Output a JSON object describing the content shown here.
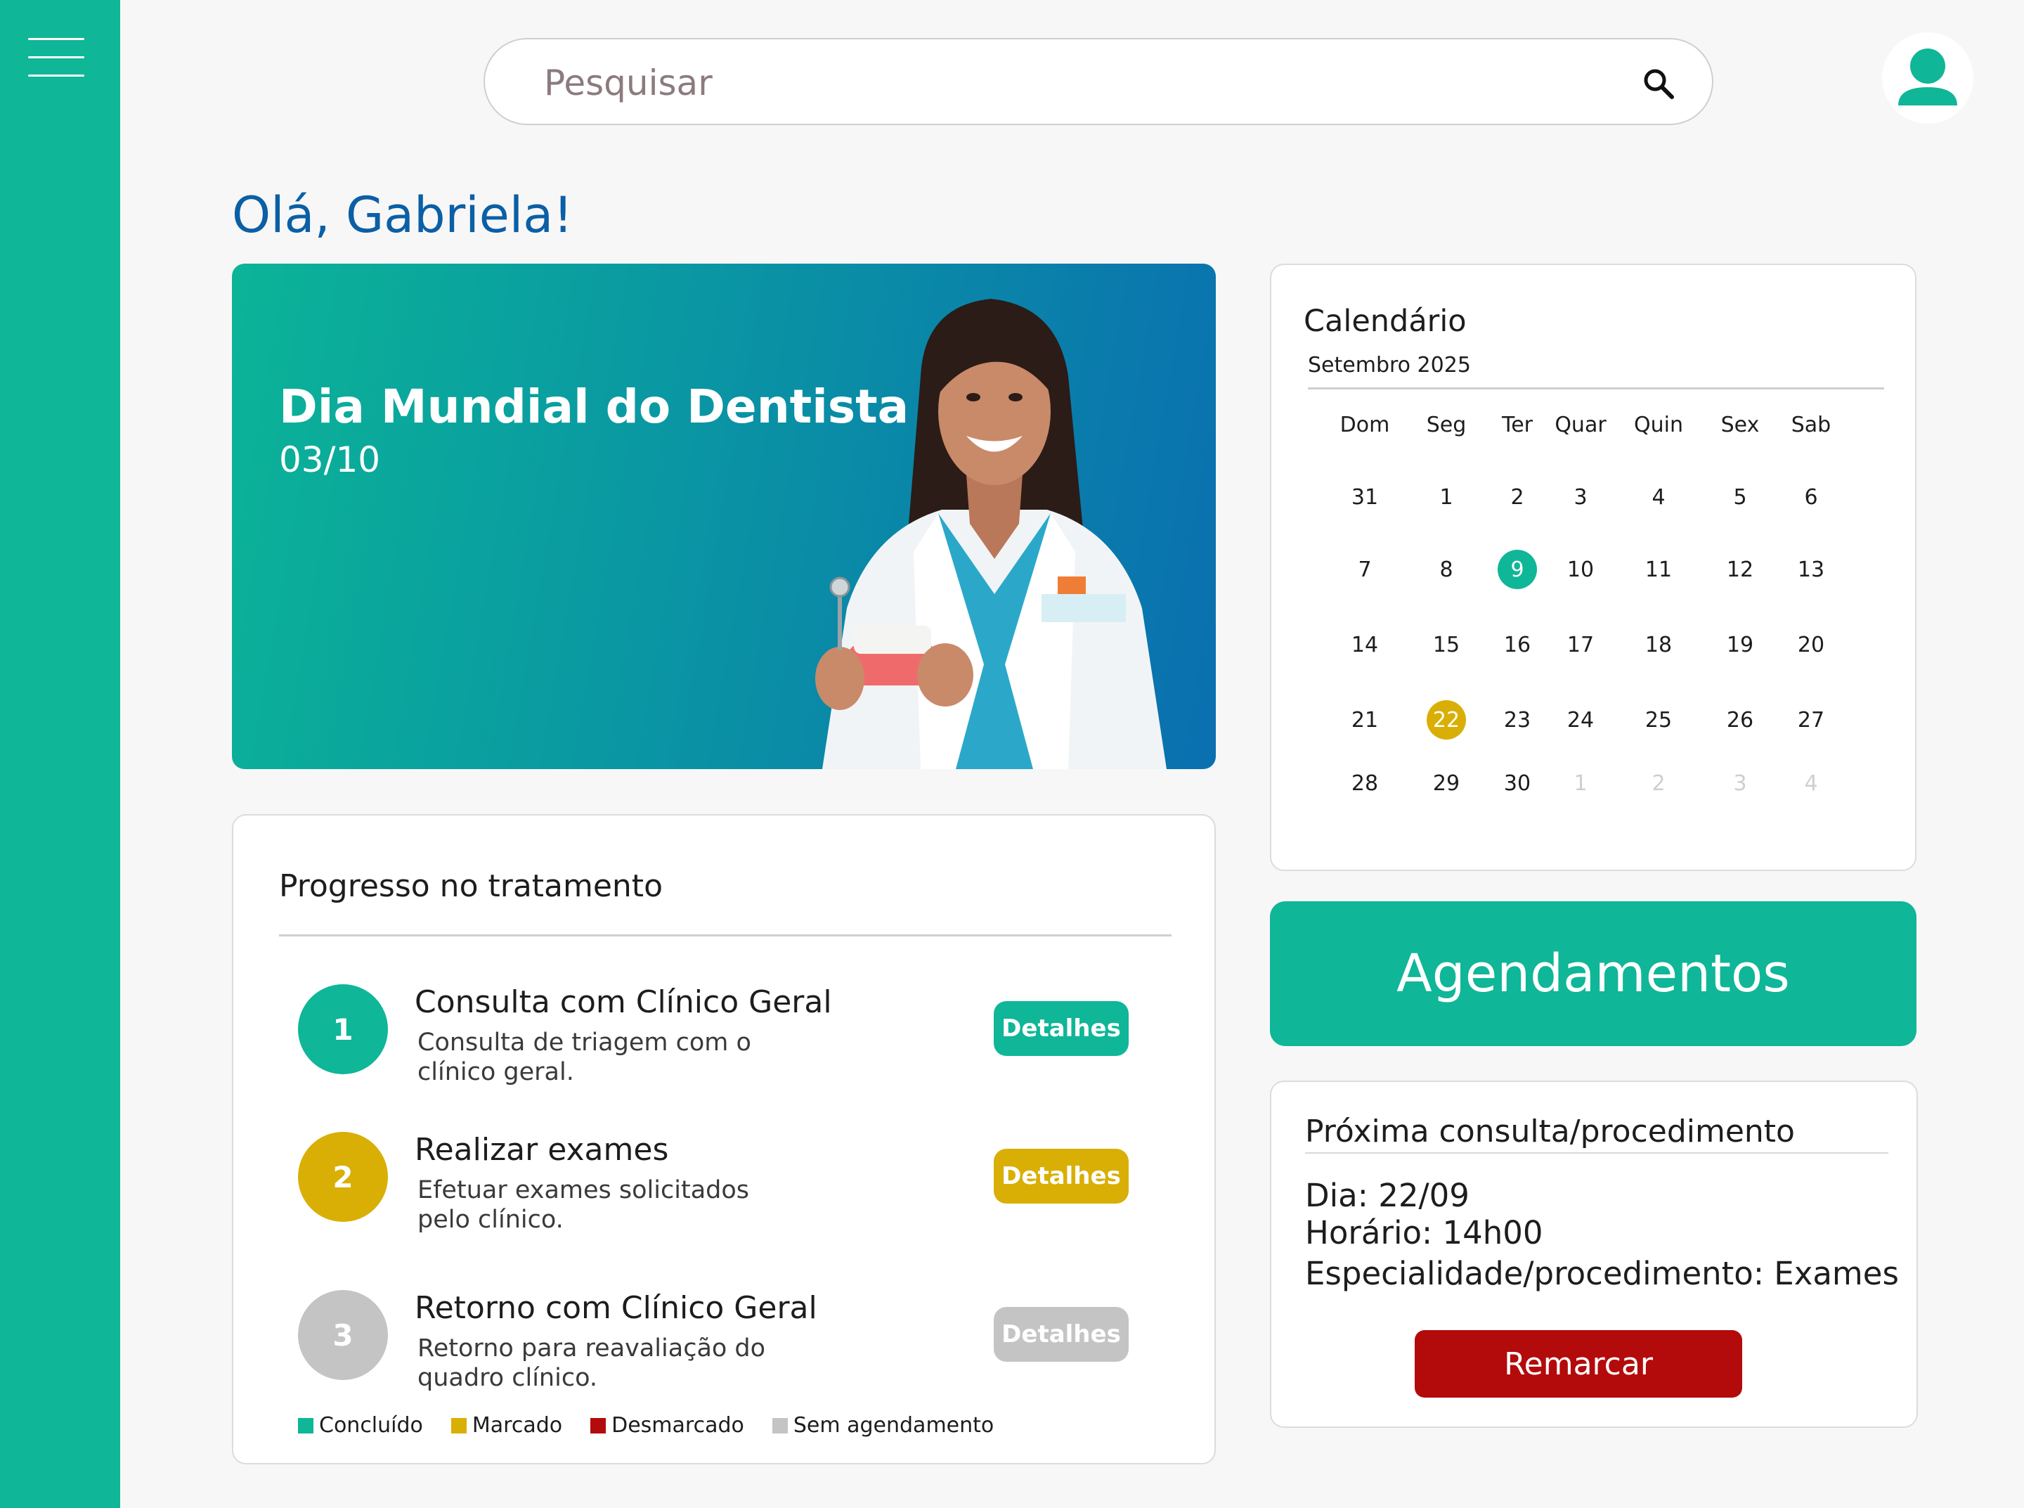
{
  "search": {
    "placeholder": "Pesquisar"
  },
  "greeting": "Olá, Gabriela!",
  "banner": {
    "title": "Dia Mundial do Dentista",
    "date": "03/10"
  },
  "progress": {
    "title": "Progresso no tratamento",
    "steps": [
      {
        "number": "1",
        "title": "Consulta com Clínico Geral",
        "description": "Consulta de triagem com o clínico geral.",
        "button": "Detalhes",
        "status": "Concluído",
        "color": "#0fb698"
      },
      {
        "number": "2",
        "title": "Realizar exames",
        "description": "Efetuar exames solicitados pelo clínico.",
        "button": "Detalhes",
        "status": "Marcado",
        "color": "#d9af05"
      },
      {
        "number": "3",
        "title": "Retorno com Clínico Geral",
        "description": "Retorno para reavaliação do quadro clínico.",
        "button": "Detalhes",
        "status": "Sem agendamento",
        "color": "#c4c4c4"
      }
    ],
    "legend": [
      {
        "label": "Concluído",
        "color": "#0fb698"
      },
      {
        "label": "Marcado",
        "color": "#d9af05"
      },
      {
        "label": "Desmarcado",
        "color": "#b30b0b"
      },
      {
        "label": "Sem agendamento",
        "color": "#c4c4c4"
      }
    ]
  },
  "calendar": {
    "title": "Calendário",
    "month": "Setembro 2025",
    "weekdays": [
      "Dom",
      "Seg",
      "Ter",
      "Quar",
      "Quin",
      "Sex",
      "Sab"
    ],
    "weeks": [
      [
        "31",
        "1",
        "2",
        "3",
        "4",
        "5",
        "6"
      ],
      [
        "7",
        "8",
        "9",
        "10",
        "11",
        "12",
        "13"
      ],
      [
        "14",
        "15",
        "16",
        "17",
        "18",
        "19",
        "20"
      ],
      [
        "21",
        "22",
        "23",
        "24",
        "25",
        "26",
        "27"
      ],
      [
        "28",
        "29",
        "30",
        "1",
        "2",
        "3",
        "4"
      ]
    ],
    "highlight_today": "9",
    "highlight_marked": "22"
  },
  "appointments_button": "Agendamentos",
  "next": {
    "title": "Próxima consulta/procedimento",
    "day": "Dia: 22/09",
    "time": "Horário: 14h00",
    "specialty": "Especialidade/procedimento: Exames",
    "reschedule_button": "Remarcar"
  },
  "colors": {
    "brand": "#0fb698",
    "blue": "#0b5fa5",
    "marked": "#d9af05",
    "cancelled": "#b30b0b",
    "unscheduled": "#c4c4c4"
  }
}
